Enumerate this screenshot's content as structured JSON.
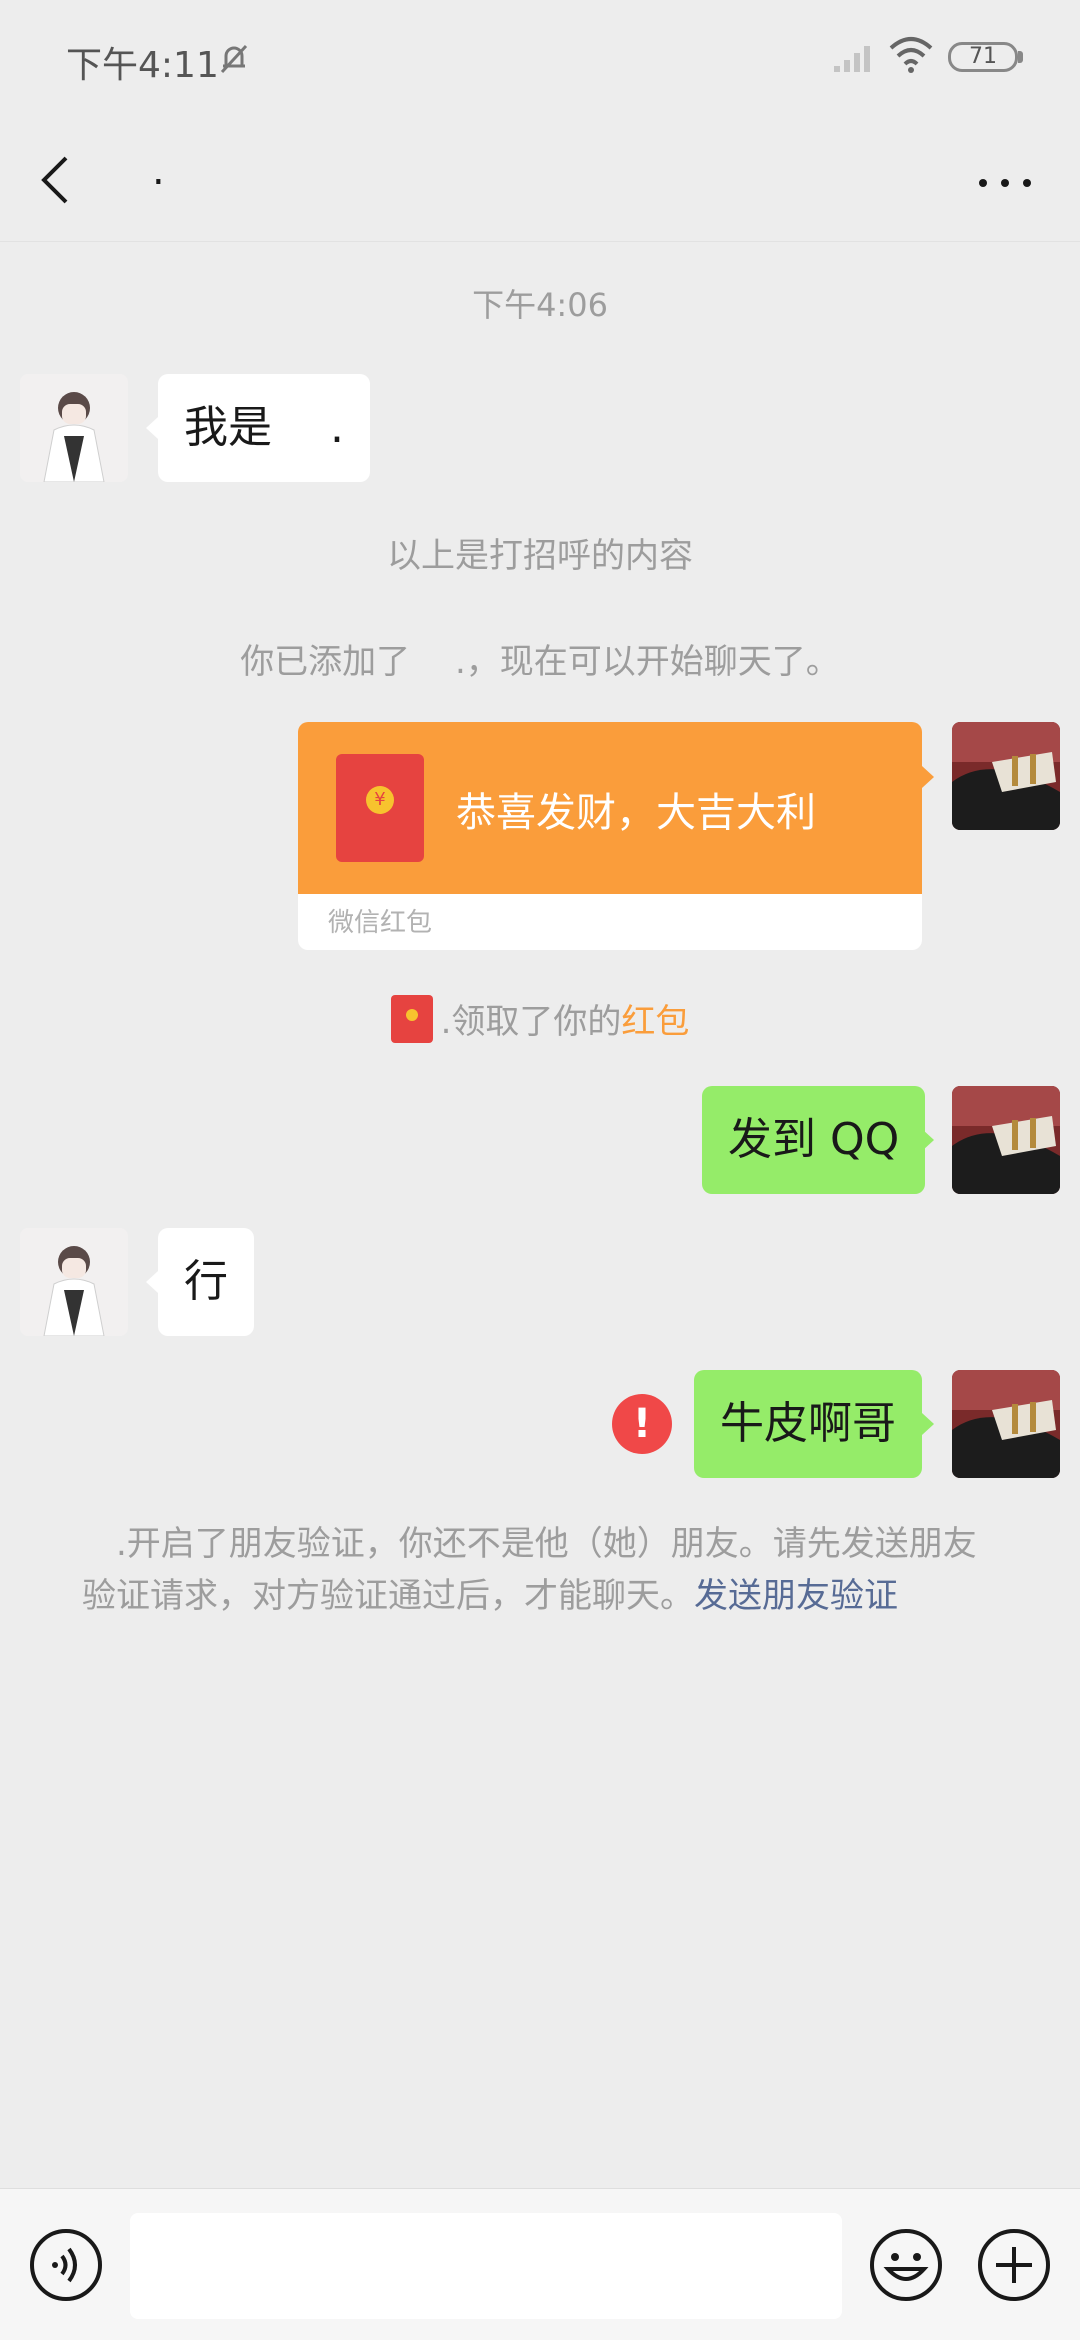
{
  "status_bar": {
    "time": "下午4:11",
    "battery": "71"
  },
  "header": {
    "title": "."
  },
  "chat": {
    "timestamp": "下午4:06",
    "messages": [
      {
        "from": "them",
        "text": "我是　 ."
      },
      {
        "from": "system",
        "text": "以上是打招呼的内容"
      },
      {
        "from": "system",
        "text": "你已添加了　 .，现在可以开始聊天了。"
      },
      {
        "from": "me",
        "type": "red_packet",
        "text": "恭喜发财，大吉大利",
        "footer": "微信红包"
      },
      {
        "from": "system",
        "text_prefix": ".领取了你的",
        "text_highlight": "红包"
      },
      {
        "from": "me",
        "text": "发到 QQ"
      },
      {
        "from": "them",
        "text": "行"
      },
      {
        "from": "me",
        "text": "牛皮啊哥",
        "status": "failed"
      }
    ],
    "verify_notice": {
      "text": "　.开启了朋友验证，你还不是他（她）朋友。请先发送朋友验证请求，对方验证通过后，才能聊天。",
      "link": "发送朋友验证"
    }
  },
  "input_bar": {
    "placeholder": ""
  },
  "icons": {
    "back": "back-arrow-icon",
    "more": "more-dots-icon",
    "voice": "voice-icon",
    "emoji": "emoji-icon",
    "plus": "plus-icon",
    "error": "error-icon"
  },
  "colors": {
    "background": "#ededed",
    "bubble_out": "#95ec69",
    "bubble_in": "#ffffff",
    "red_packet": "#fa9d3b",
    "link": "#576b95",
    "error": "#f04848"
  }
}
